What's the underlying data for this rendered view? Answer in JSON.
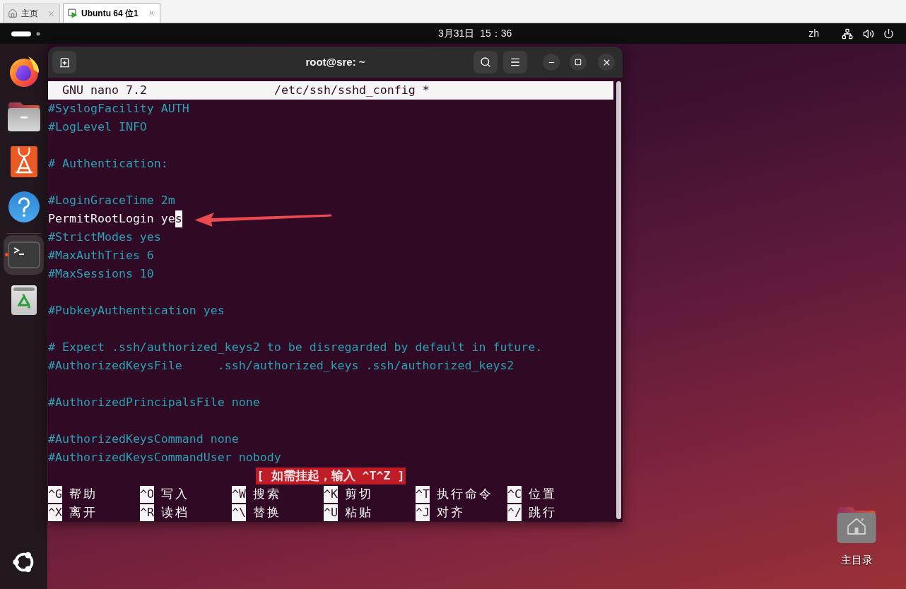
{
  "host_tabs": [
    {
      "kind": "home",
      "label": "主页",
      "selected": false
    },
    {
      "kind": "vm",
      "label": "Ubuntu 64 位1",
      "selected": true
    }
  ],
  "top_bar": {
    "clock": "3月31日  15：36",
    "input_method": "zh"
  },
  "dock": {
    "pinned": [
      {
        "kind": "browser",
        "selected": false,
        "running": false
      },
      {
        "kind": "files",
        "selected": false,
        "running": false
      },
      {
        "kind": "software",
        "selected": false,
        "running": false
      },
      {
        "kind": "help",
        "selected": false,
        "running": false
      }
    ],
    "others": [
      {
        "kind": "terminal",
        "selected": true,
        "running": true
      },
      {
        "kind": "trash",
        "selected": false,
        "running": false
      }
    ]
  },
  "terminal": {
    "title": "root@sre: ~",
    "nano": {
      "version": "GNU nano 7.2",
      "file": "/etc/ssh/sshd_config *",
      "blocks": [
        {
          "lines": [
            {
              "kind": "comment",
              "text": "#SyslogFacility AUTH"
            },
            {
              "kind": "comment",
              "text": "#LogLevel INFO"
            }
          ]
        },
        {
          "lines": [
            {
              "kind": "comment",
              "text": "# Authentication:"
            }
          ]
        },
        {
          "lines": [
            {
              "kind": "comment",
              "text": "#LoginGraceTime 2m"
            },
            {
              "kind": "setting",
              "text": "PermitRootLogin ye",
              "cursor": "s"
            },
            {
              "kind": "comment",
              "text": "#StrictModes yes"
            },
            {
              "kind": "comment",
              "text": "#MaxAuthTries 6"
            },
            {
              "kind": "comment",
              "text": "#MaxSessions 10"
            }
          ]
        },
        {
          "lines": [
            {
              "kind": "comment",
              "text": "#PubkeyAuthentication yes"
            }
          ]
        },
        {
          "lines": [
            {
              "kind": "comment",
              "text": "# Expect .ssh/authorized_keys2 to be disregarded by default in future."
            },
            {
              "kind": "comment",
              "text": "#AuthorizedKeysFile     .ssh/authorized_keys .ssh/authorized_keys2"
            }
          ]
        },
        {
          "lines": [
            {
              "kind": "comment",
              "text": "#AuthorizedPrincipalsFile none"
            }
          ]
        },
        {
          "lines": [
            {
              "kind": "comment",
              "text": "#AuthorizedKeysCommand none"
            },
            {
              "kind": "comment",
              "text": "#AuthorizedKeysCommandUser nobody"
            }
          ]
        }
      ],
      "status": "[ 如需挂起，输入 ^T^Z ]",
      "shortcut_rows": [
        {
          "items": [
            {
              "key": "^G",
              "label": "帮助"
            },
            {
              "key": "^O",
              "label": "写入"
            },
            {
              "key": "^W",
              "label": "搜索"
            },
            {
              "key": "^K",
              "label": "剪切"
            },
            {
              "key": "^T",
              "label": "执行命令"
            },
            {
              "key": "^C",
              "label": "位置"
            }
          ]
        },
        {
          "items": [
            {
              "key": "^X",
              "label": "离开"
            },
            {
              "key": "^R",
              "label": "读档"
            },
            {
              "key": "^\\",
              "label": "替换"
            },
            {
              "key": "^U",
              "label": "粘贴"
            },
            {
              "key": "^J",
              "label": "对齐"
            },
            {
              "key": "^/",
              "label": "跳行"
            }
          ]
        }
      ]
    }
  },
  "desktop_icons": [
    {
      "kind": "home_folder",
      "label": "主目录"
    }
  ]
}
